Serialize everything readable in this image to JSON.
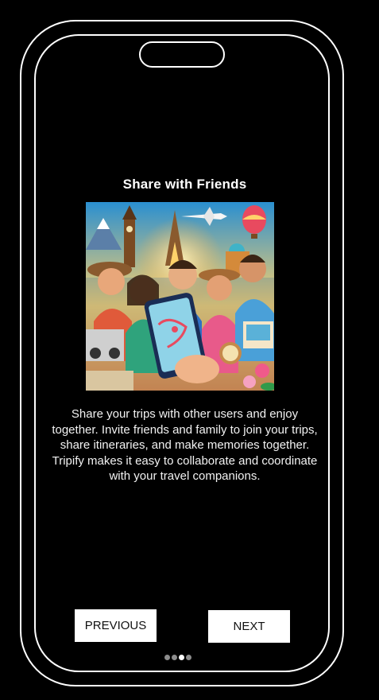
{
  "screen": {
    "title": "Share with Friends",
    "description": "Share your trips with other users and enjoy together. Invite friends and family to join your trips, share itineraries, and make memories together. Tripify makes it easy to collaborate and coordinate with your travel companions.",
    "hero_image": "group-of-friends-sharing-trip-on-phone-illustration"
  },
  "buttons": {
    "previous_label": "PREVIOUS",
    "next_label": "NEXT"
  },
  "pagination": {
    "total": 4,
    "current": 3
  }
}
